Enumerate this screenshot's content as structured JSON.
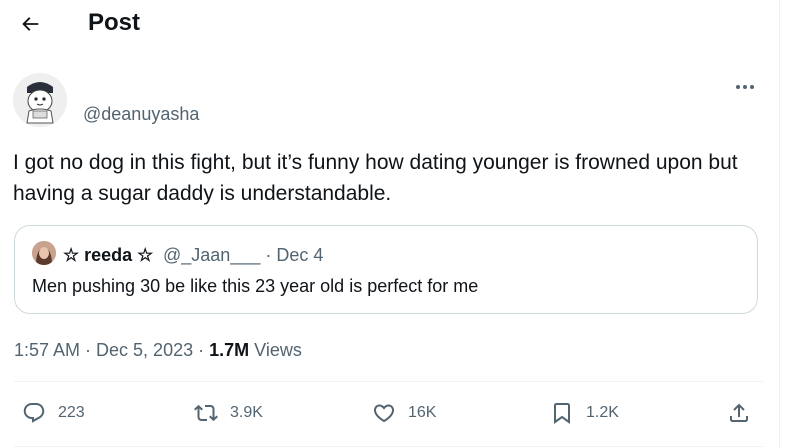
{
  "header": {
    "title": "Post",
    "back_icon": "arrow-left-icon"
  },
  "post": {
    "handle": "@deanuyasha",
    "text": "I got no dog in this fight, but it’s funny how dating younger is frowned upon but having a sugar daddy is understandable.",
    "timestamp": "1:57 AM · Dec 5, 2023 · ",
    "views_count": "1.7M",
    "views_label": " Views"
  },
  "quote": {
    "name": "☆ reeda ☆",
    "handle_date": "@_Jaan___ · Dec 4",
    "text": "Men pushing 30 be like this 23 year old is perfect for me"
  },
  "actions": {
    "replies": "223",
    "reposts": "3.9K",
    "likes": "16K",
    "bookmarks": "1.2K"
  },
  "colors": {
    "text_primary": "#0f1419",
    "text_secondary": "#536471",
    "border": "#cfd9de",
    "divider": "#eff3f4"
  }
}
